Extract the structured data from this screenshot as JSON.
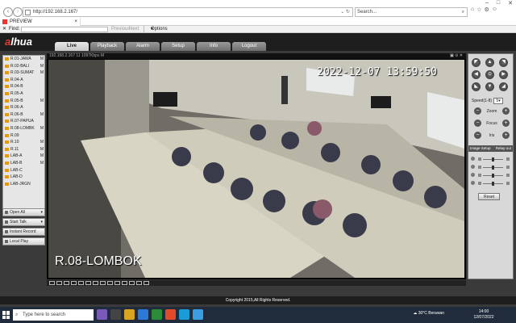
{
  "browser": {
    "url": "http://192.168.2.167/",
    "search_placeholder": "Search...",
    "tab_title": "PREVIEW",
    "find_label": "Find:",
    "find_prev": "Previous",
    "find_next": "Next",
    "options_label": "Options"
  },
  "app": {
    "menu": [
      "Live",
      "Playback",
      "Alarm",
      "Setup",
      "Info",
      "Logout"
    ],
    "active_menu": "Live",
    "channels": [
      {
        "name": "R.01-JAWA",
        "m": "M"
      },
      {
        "name": "R.02-BALI",
        "m": "M"
      },
      {
        "name": "R.03-SUMAT",
        "m": "M"
      },
      {
        "name": "R.04-A",
        "m": ""
      },
      {
        "name": "R.04-B",
        "m": ""
      },
      {
        "name": "R.05-A",
        "m": ""
      },
      {
        "name": "R.05-B",
        "m": "M"
      },
      {
        "name": "R.06-A",
        "m": ""
      },
      {
        "name": "R.06-B",
        "m": "M"
      },
      {
        "name": "R.07-PAPUA",
        "m": ""
      },
      {
        "name": "R.08-LOMBK",
        "m": "M"
      },
      {
        "name": "R.09",
        "m": ""
      },
      {
        "name": "R.10",
        "m": "M"
      },
      {
        "name": "R.11",
        "m": "M"
      },
      {
        "name": "LAB-A",
        "m": "M"
      },
      {
        "name": "LAB-B",
        "m": "M"
      },
      {
        "name": "LAB-C",
        "m": ""
      },
      {
        "name": "LAB-D",
        "m": ""
      },
      {
        "name": "LAB-JRGN",
        "m": ""
      },
      {
        "name": "",
        "m": ""
      }
    ],
    "buttons": {
      "open_all": "Open All",
      "start_talk": "Start Talk",
      "instant_record": "Instant Record",
      "local_play": "Local Play"
    },
    "video": {
      "stream_info": "192.168.2.167 11 1097Kbps M",
      "timestamp": "2022-12-07 13:59:50",
      "camera_name": "R.08-LOMBOK"
    },
    "ptz": {
      "speed_label": "Speed(1-8)",
      "speed_value": "5",
      "zoom": "Zoom",
      "focus": "Focus",
      "iris": "Iris"
    },
    "image_setup": {
      "label": "Image Setup",
      "relay": "Relay-out",
      "reset": "Reset",
      "levels": [
        0.5,
        0.5,
        0.5,
        0.5
      ]
    },
    "footer": "Copyright 2015,All Rights Reserved."
  },
  "taskbar": {
    "search": "Type here to search",
    "weather": "30°C  Berawan",
    "time": "14:00",
    "date": "12/07/2022"
  }
}
